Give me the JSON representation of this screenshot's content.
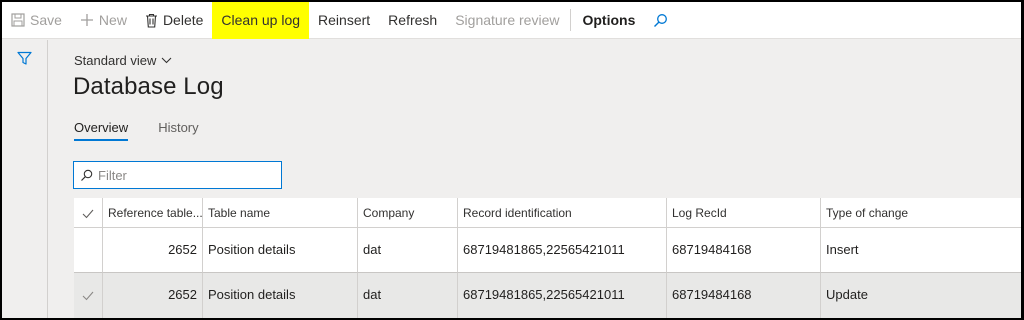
{
  "toolbar": {
    "save": "Save",
    "new": "New",
    "delete": "Delete",
    "clean_up_log": "Clean up log",
    "reinsert": "Reinsert",
    "refresh": "Refresh",
    "signature_review": "Signature review",
    "options": "Options",
    "highlight_color": "#ffff00",
    "search_icon": "search-icon"
  },
  "view": {
    "selector": "Standard view"
  },
  "page": {
    "title": "Database Log"
  },
  "tabs": [
    {
      "label": "Overview",
      "active": true
    },
    {
      "label": "History",
      "active": false
    }
  ],
  "filter": {
    "placeholder": "Filter",
    "value": ""
  },
  "grid": {
    "columns": [
      "Reference table...",
      "Table name",
      "Company",
      "Record identification",
      "Log RecId",
      "Type of change"
    ],
    "rows": [
      {
        "ref_table": "2652",
        "table_name": "Position details",
        "company": "dat",
        "record_id": "68719481865,22565421011",
        "log_recid": "68719484168",
        "type_of_change": "Insert",
        "selected": false
      },
      {
        "ref_table": "2652",
        "table_name": "Position details",
        "company": "dat",
        "record_id": "68719481865,22565421011",
        "log_recid": "68719484168",
        "type_of_change": "Update",
        "selected": true
      }
    ]
  },
  "colors": {
    "accent": "#0078d4"
  }
}
